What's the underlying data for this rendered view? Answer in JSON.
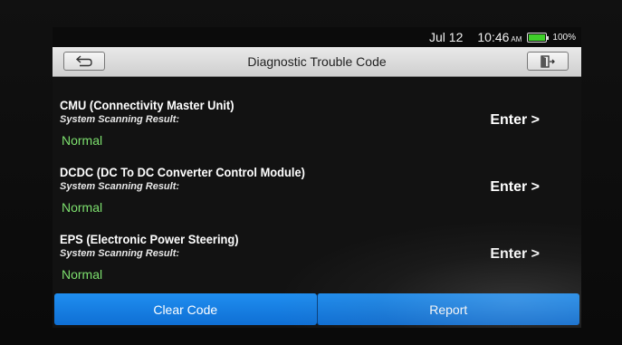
{
  "status": {
    "date": "Jul 12",
    "time": "10:46",
    "ampm": "AM",
    "battery_level": 100,
    "battery_text": "100%"
  },
  "header": {
    "title": "Diagnostic Trouble Code"
  },
  "icons": {
    "back": "back-arrow-icon",
    "exit": "exit-door-icon"
  },
  "modules": [
    {
      "name": "CMU (Connectivity Master Unit)",
      "result_label": "System Scanning Result:",
      "status": "Normal",
      "action": "Enter >"
    },
    {
      "name": "DCDC (DC To DC Converter Control Module)",
      "result_label": "System Scanning Result:",
      "status": "Normal",
      "action": "Enter >"
    },
    {
      "name": "EPS (Electronic Power Steering)",
      "result_label": "System Scanning Result:",
      "status": "Normal",
      "action": "Enter >"
    }
  ],
  "footer": {
    "clear_label": "Clear Code",
    "report_label": "Report"
  },
  "colors": {
    "accent": "#1a86ea",
    "status_ok": "#7de06e",
    "battery": "#3fcf2a"
  }
}
